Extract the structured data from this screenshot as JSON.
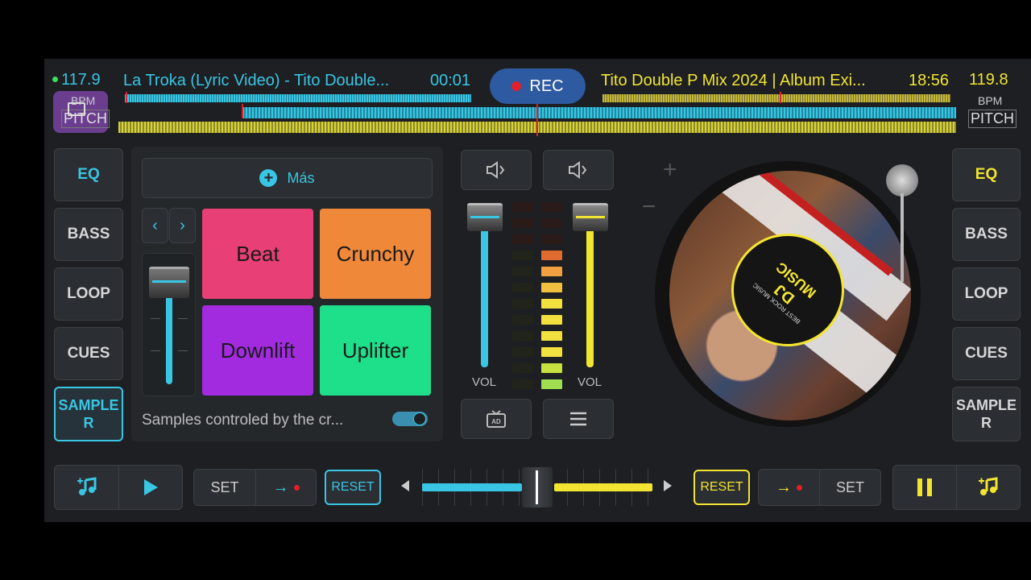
{
  "deck_left": {
    "bpm": "117.9",
    "bpm_label": "BPM",
    "pitch_label": "PITCH",
    "title": "La Troka (Lyric Video) - Tito Double...",
    "time": "00:01",
    "color": "#39c6e4"
  },
  "deck_right": {
    "bpm": "119.8",
    "bpm_label": "BPM",
    "pitch_label": "PITCH",
    "title": "Tito Double P Mix 2024 | Album Exi...",
    "time": "18:56",
    "color": "#f2e531"
  },
  "rec_label": "REC",
  "left_side": [
    "EQ",
    "BASS",
    "LOOP",
    "CUES",
    "SAMPLE R"
  ],
  "right_side": [
    "EQ",
    "BASS",
    "LOOP",
    "CUES",
    "SAMPLE R"
  ],
  "sampler": {
    "more_label": "Más",
    "pads": [
      {
        "label": "Beat",
        "color": "#e83f76"
      },
      {
        "label": "Crunchy",
        "color": "#f0883a"
      },
      {
        "label": "Downlift",
        "color": "#a22be0"
      },
      {
        "label": "Uplifter",
        "color": "#1fe08a"
      }
    ],
    "footer_text": "Samples controled by the cr...",
    "toggle_on": true
  },
  "mixer": {
    "vol_left_label": "VOL",
    "vol_right_label": "VOL",
    "vol_left_level": 0.92,
    "vol_right_level": 0.92
  },
  "turntable": {
    "label_line1": "DJ",
    "label_line2": "MUSIC",
    "label_ring": "BEST ROCK MUSIC",
    "plus": "+",
    "minus": "−"
  },
  "bottom": {
    "set_left": "SET",
    "reset_left": "RESET",
    "reset_right": "RESET",
    "set_right": "SET",
    "crossfader_position": 0.5
  },
  "icons": {
    "add": "plus-circle-icon",
    "prev": "chevron-left-icon",
    "next": "chevron-right-icon",
    "speaker": "speaker-icon",
    "tv": "ad-tv-icon",
    "menu": "hamburger-menu-icon",
    "music_add": "music-add-icon",
    "play": "play-icon",
    "pause": "pause-icon",
    "arrow_rec": "arrow-record-icon"
  }
}
